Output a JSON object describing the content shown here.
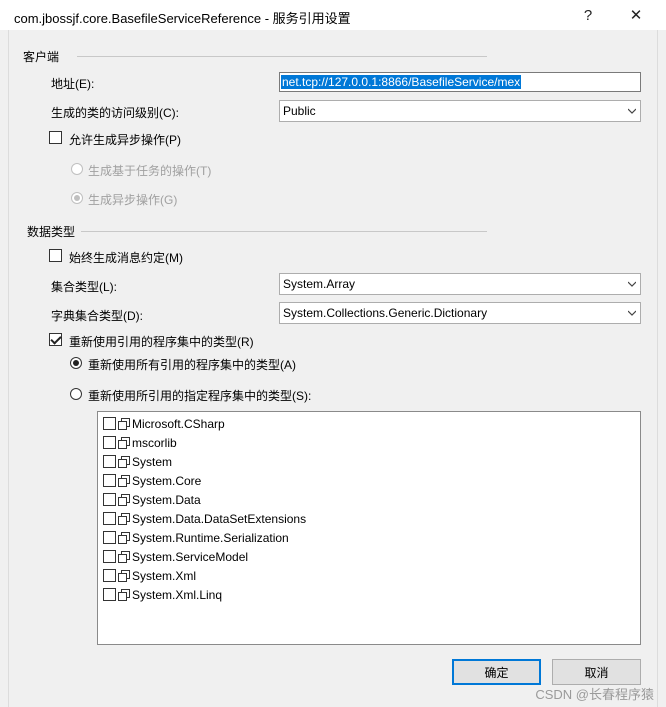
{
  "window": {
    "title": "com.jbossjf.core.BasefileServiceReference - 服务引用设置",
    "help_label": "?",
    "close_label": "✕"
  },
  "client": {
    "group_title": "客户端",
    "address_label": "地址(E):",
    "address_value": "net.tcp://127.0.0.1:8866/BasefileService/mex",
    "access_label": "生成的类的访问级别(C):",
    "access_value": "Public",
    "async_label": "允许生成异步操作(P)",
    "task_label": "生成基于任务的操作(T)",
    "async_ops_label": "生成异步操作(G)"
  },
  "datatype": {
    "group_title": "数据类型",
    "always_contract_label": "始终生成消息约定(M)",
    "collection_label": "集合类型(L):",
    "collection_value": "System.Array",
    "dict_label": "字典集合类型(D):",
    "dict_value": "System.Collections.Generic.Dictionary",
    "reuse_label": "重新使用引用的程序集中的类型(R)",
    "reuse_all_label": "重新使用所有引用的程序集中的类型(A)",
    "reuse_specified_label": "重新使用所引用的指定程序集中的类型(S):",
    "assemblies": [
      "Microsoft.CSharp",
      "mscorlib",
      "System",
      "System.Core",
      "System.Data",
      "System.Data.DataSetExtensions",
      "System.Runtime.Serialization",
      "System.ServiceModel",
      "System.Xml",
      "System.Xml.Linq"
    ]
  },
  "buttons": {
    "ok_label": "确定",
    "cancel_label": "取消"
  },
  "watermark": "CSDN @长春程序猿",
  "colors": {
    "accent": "#0078d7",
    "dialog_bg": "#f0f0f0",
    "disabled_text": "#a0a0a0"
  }
}
